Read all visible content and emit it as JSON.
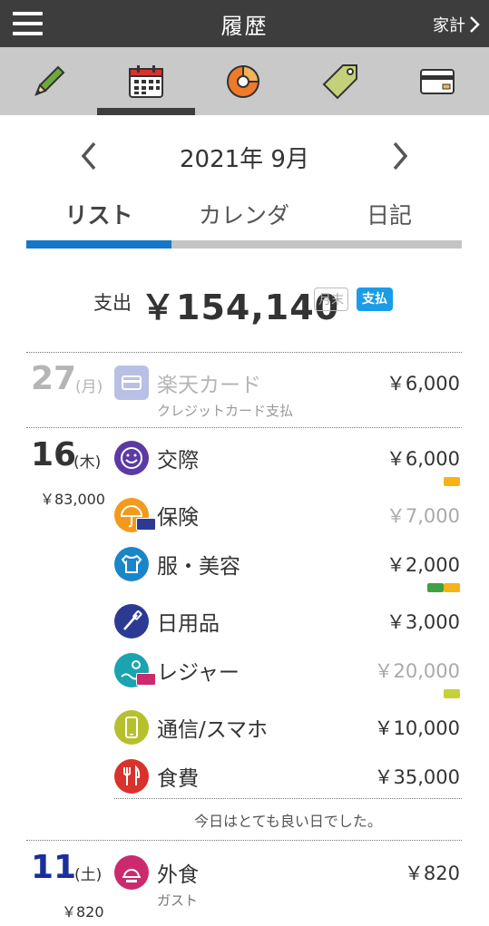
{
  "header": {
    "title": "履歴",
    "right_link": "家計"
  },
  "toolbar": {
    "items": [
      "pencil-icon",
      "calendar-icon",
      "pie-icon",
      "tag-icon",
      "card-icon"
    ],
    "active_index": 1
  },
  "month": {
    "label": "2021年 9月"
  },
  "tabs": [
    {
      "label": "リスト"
    },
    {
      "label": "カレンダ"
    },
    {
      "label": "日記"
    }
  ],
  "summary": {
    "label": "支出",
    "amount": "￥154,140",
    "badge_month": "月末",
    "badge_pay": "支払"
  },
  "days": [
    {
      "day": "27",
      "dow": "(月)",
      "total": "",
      "entries": [
        {
          "name": "楽天カード",
          "sub": "クレジットカード支払",
          "amount": "￥6,000",
          "color": "#b9c0e6"
        }
      ]
    },
    {
      "day": "16",
      "dow": "(木)",
      "total": "￥83,000",
      "entries": [
        {
          "name": "交際",
          "amount": "￥6,000",
          "color": "#5b3aa3"
        },
        {
          "name": "保険",
          "amount": "￥7,000",
          "color": "#f39a1c"
        },
        {
          "name": "服・美容",
          "amount": "￥2,000",
          "color": "#1a86c9"
        },
        {
          "name": "日用品",
          "amount": "￥3,000",
          "color": "#2d3a94"
        },
        {
          "name": "レジャー",
          "amount": "￥20,000",
          "color": "#1aa3b0"
        },
        {
          "name": "通信/スマホ",
          "amount": "￥10,000",
          "color": "#b6c02c"
        },
        {
          "name": "食費",
          "amount": "￥35,000",
          "color": "#d9312b"
        }
      ],
      "memo": "今日はとても良い日でした。"
    },
    {
      "day": "11",
      "dow": "(土)",
      "total": "￥820",
      "entries": [
        {
          "name": "外食",
          "sub": "ガスト",
          "amount": "￥820",
          "color": "#cc2a6e"
        }
      ]
    }
  ],
  "colors": {
    "tag_orange": "#f5b318",
    "tag_green": "#3fa143",
    "tag_lime": "#c5d13a",
    "saturday_blue": "#1a2f9c",
    "accent_blue": "#1677c8"
  }
}
